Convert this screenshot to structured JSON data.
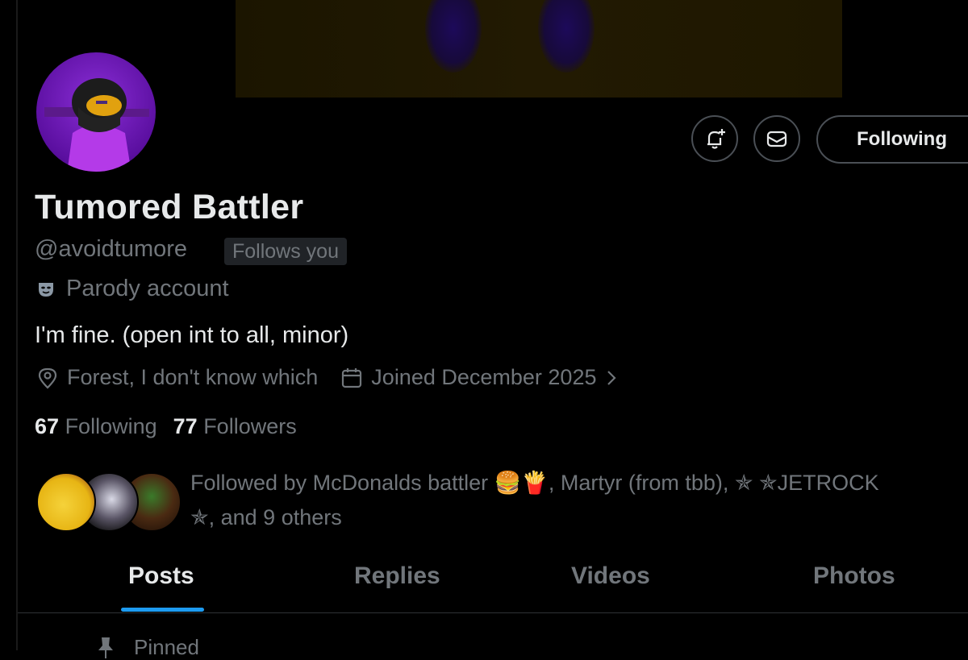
{
  "profile": {
    "display_name": "Tumored Battler",
    "handle": "@avoidtumore",
    "follows_you_badge": "Follows you",
    "account_label": "Parody account",
    "bio": "I'm fine. (open int to all, minor)",
    "location": "Forest, I don't know which",
    "joined": "Joined December 2025"
  },
  "actions": {
    "following_label": "Following",
    "notify_icon": "bell-plus-icon",
    "message_icon": "envelope-icon"
  },
  "counts": {
    "following_count": "67",
    "following_label": "Following",
    "followers_count": "77",
    "followers_label": "Followers"
  },
  "followed_by": {
    "text_line1": "Followed by McDonalds battler 🍔🍟, Martyr (from tbb), ✯ ✯JETROCK",
    "text_line2": "✯, and 9 others"
  },
  "tabs": [
    {
      "label": "Posts",
      "active": true
    },
    {
      "label": "Replies",
      "active": false
    },
    {
      "label": "Videos",
      "active": false
    },
    {
      "label": "Photos",
      "active": false
    }
  ],
  "pinned_label": "Pinned",
  "colors": {
    "background": "#000000",
    "primary_text": "#e7e9ea",
    "secondary_text": "#71767b",
    "accent": "#1d9bf0"
  }
}
